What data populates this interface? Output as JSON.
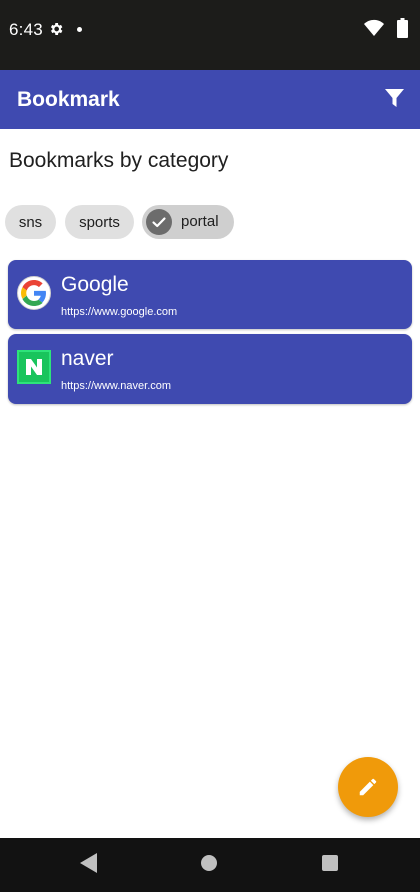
{
  "status_bar": {
    "time": "6:43",
    "icons": [
      "gear-icon",
      "notification-dot",
      "wifi-icon",
      "battery-icon"
    ]
  },
  "app_bar": {
    "title": "Bookmark",
    "actions": [
      {
        "icon": "filter-icon"
      }
    ],
    "color": "#3f4ab0"
  },
  "page": {
    "heading": "Bookmarks by category"
  },
  "chips": [
    {
      "label": "sns",
      "selected": false
    },
    {
      "label": "sports",
      "selected": false
    },
    {
      "label": "portal",
      "selected": true
    }
  ],
  "bookmarks": [
    {
      "title": "Google",
      "url": "https://www.google.com",
      "icon": "google-favicon"
    },
    {
      "title": "naver",
      "url": "https://www.naver.com",
      "icon": "naver-favicon"
    }
  ],
  "fab": {
    "icon": "pencil-icon",
    "color": "#f09a0a"
  },
  "nav_bar": {
    "icons": [
      "back-icon",
      "home-icon",
      "recents-icon"
    ]
  }
}
